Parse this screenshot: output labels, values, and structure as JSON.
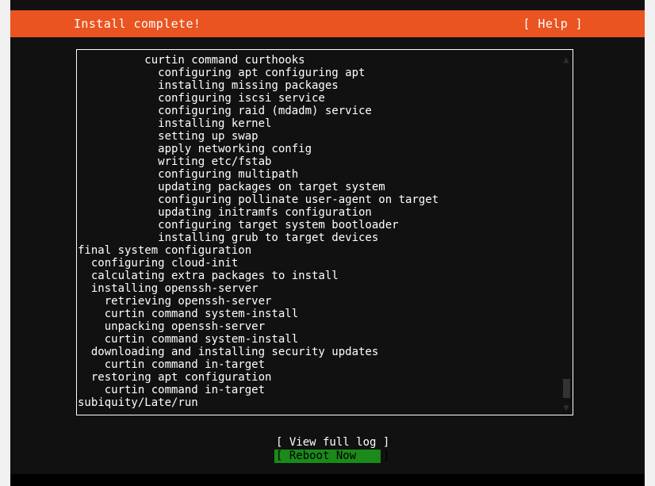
{
  "header": {
    "title": "Install complete!",
    "help_label": "[ Help ]"
  },
  "colors": {
    "accent_orange": "#e95420",
    "terminal_bg": "#111111",
    "selected_green": "#1a8a1a",
    "text_white": "#ffffff",
    "page_bg": "#f0f0f0"
  },
  "log": {
    "lines": [
      "          curtin command curthooks",
      "            configuring apt configuring apt",
      "            installing missing packages",
      "            configuring iscsi service",
      "            configuring raid (mdadm) service",
      "            installing kernel",
      "            setting up swap",
      "            apply networking config",
      "            writing etc/fstab",
      "            configuring multipath",
      "            updating packages on target system",
      "            configuring pollinate user-agent on target",
      "            updating initramfs configuration",
      "            configuring target system bootloader",
      "            installing grub to target devices",
      "final system configuration",
      "  configuring cloud-init",
      "  calculating extra packages to install",
      "  installing openssh-server",
      "    retrieving openssh-server",
      "    curtin command system-install",
      "    unpacking openssh-server",
      "    curtin command system-install",
      "  downloading and installing security updates",
      "    curtin command in-target",
      "  restoring apt configuration",
      "    curtin command in-target",
      "subiquity/Late/run"
    ]
  },
  "scrollbar": {
    "up_arrow": "▲",
    "down_arrow": "▼"
  },
  "buttons": [
    {
      "label": "[ View full log ]",
      "selected": false
    },
    {
      "label": "[ Reboot Now    ]",
      "selected": true
    }
  ]
}
